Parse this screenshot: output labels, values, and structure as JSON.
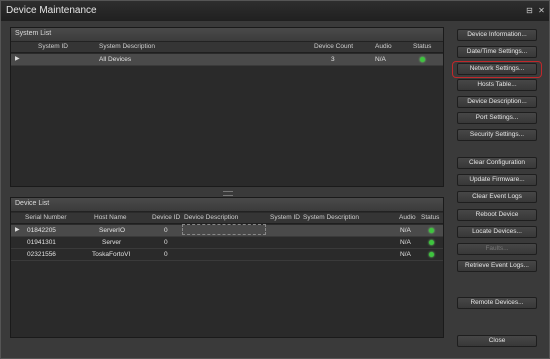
{
  "window": {
    "title": "Device Maintenance",
    "controls": [
      "⊟",
      "✕"
    ]
  },
  "system_list": {
    "title": "System List",
    "columns": [
      "System ID",
      "System Description",
      "Device Count",
      "Audio",
      "Status"
    ],
    "rows": [
      {
        "system_id": "",
        "description": "All Devices",
        "count": "3",
        "audio": "N/A",
        "status": "online"
      }
    ]
  },
  "device_list": {
    "title": "Device List",
    "columns": [
      "Serial Number",
      "Host Name",
      "Device ID",
      "Device Description",
      "System ID",
      "System Description",
      "Audio",
      "Status"
    ],
    "rows": [
      {
        "serial": "01842205",
        "host": "ServerIO",
        "device_id": "0",
        "audio": "N/A",
        "status": "online"
      },
      {
        "serial": "01941301",
        "host": "Server",
        "device_id": "0",
        "audio": "N/A",
        "status": "online"
      },
      {
        "serial": "02321556",
        "host": "ToskaFortoVI",
        "device_id": "0",
        "audio": "N/A",
        "status": "online"
      }
    ]
  },
  "buttons": {
    "device_information": "Device Information...",
    "date_time_settings": "Date/Time Settings...",
    "network_settings": "Network Settings...",
    "hosts_table": "Hosts Table...",
    "device_description": "Device Description...",
    "port_settings": "Port Settings...",
    "security_settings": "Security Settings...",
    "clear_configuration": "Clear Configuration",
    "update_firmware": "Update Firmware...",
    "clear_event_logs": "Clear Event Logs",
    "reboot_device": "Reboot Device",
    "locate_devices": "Locate Devices...",
    "faults": "Faults...",
    "retrieve_event_logs": "Retrieve Event Logs...",
    "remote_devices": "Remote Devices...",
    "close": "Close"
  },
  "colors": {
    "status_online": "#3ec43e",
    "highlight": "#c0282b"
  }
}
